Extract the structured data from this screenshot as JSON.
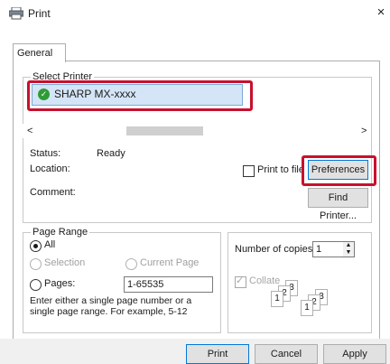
{
  "window": {
    "title": "Print",
    "close": "×"
  },
  "tabs": [
    {
      "label": "General"
    }
  ],
  "select_printer": {
    "label": "Select Printer",
    "printers": [
      {
        "name": "SHARP MX-xxxx",
        "selected": true
      }
    ]
  },
  "status": {
    "status_label": "Status:",
    "status_value": "Ready",
    "location_label": "Location:",
    "location_value": "",
    "comment_label": "Comment:",
    "comment_value": ""
  },
  "print_to_file": {
    "label": "Print to file",
    "checked": false
  },
  "buttons": {
    "preferences": "Preferences",
    "find_printer": "Find Printer...",
    "print": "Print",
    "cancel": "Cancel",
    "apply": "Apply"
  },
  "page_range": {
    "label": "Page Range",
    "all": "All",
    "selection": "Selection",
    "current_page": "Current Page",
    "pages": "Pages:",
    "pages_value": "1-65535",
    "help": "Enter either a single page number or a single page range.  For example, 5-12"
  },
  "copies": {
    "label": "Number of copies:",
    "value": "1",
    "collate": "Collate",
    "collate_checked": true
  },
  "scroll": {
    "left": "<",
    "right": ">"
  },
  "colors": {
    "highlight": "#c8102e",
    "selection": "#d4e5f7"
  }
}
